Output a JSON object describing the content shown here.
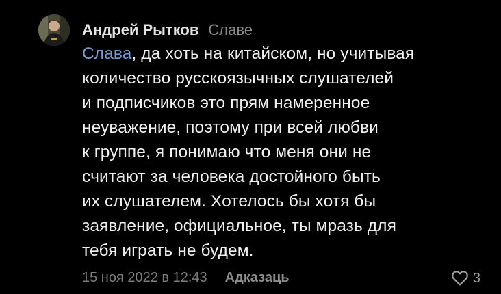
{
  "comment": {
    "author": "Андрей Рытков",
    "reply_to": "Славе",
    "mention": "Слава",
    "text_lines": [
      ", да хоть на китайском, но учитывая",
      "количество русскоязычных слушателей",
      "и подписчиков это прям намеренное",
      "неуважение, поэтому при всей любви",
      "к группе, я понимаю что меня они не",
      "считают за человека достойного быть",
      "их слушателем. Хотелось бы хотя бы",
      "заявление, официальное, ты мразь для",
      "тебя играть не будем."
    ],
    "timestamp": "15 ноя 2022 в 12:43",
    "reply_label": "Адказаць",
    "likes": "3",
    "icons": {
      "avatar": "avatar-photo",
      "like": "heart-outline-icon"
    }
  },
  "colors": {
    "background": "#000000",
    "text": "#f0f0f0",
    "mention": "#6f9ed8",
    "muted": "#7d7d7d"
  }
}
